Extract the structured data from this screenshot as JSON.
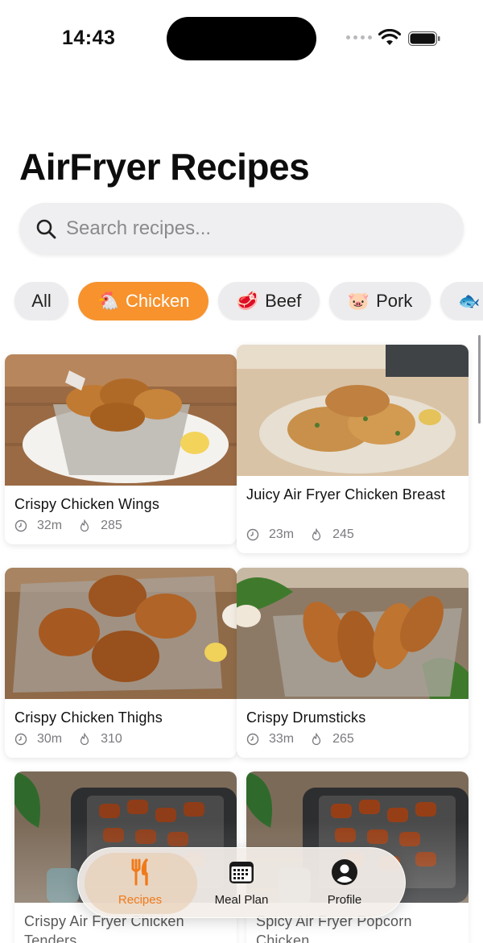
{
  "status_bar": {
    "time": "14:43"
  },
  "header": {
    "title": "AirFryer Recipes"
  },
  "search": {
    "placeholder": "Search recipes..."
  },
  "categories": [
    {
      "label": "All",
      "emoji": "",
      "active": false
    },
    {
      "label": "Chicken",
      "emoji": "🐔",
      "active": true
    },
    {
      "label": "Beef",
      "emoji": "🥩",
      "active": false
    },
    {
      "label": "Pork",
      "emoji": "🐷",
      "active": false
    },
    {
      "label": "",
      "emoji": "🐟",
      "active": false
    }
  ],
  "recipes": [
    {
      "title": "Crispy Chicken Wings",
      "time": "32m",
      "calories": "285"
    },
    {
      "title": "Juicy Air Fryer Chicken Breast",
      "time": "23m",
      "calories": "245"
    },
    {
      "title": "Crispy Chicken Thighs",
      "time": "30m",
      "calories": "310"
    },
    {
      "title": "Crispy Drumsticks",
      "time": "33m",
      "calories": "265"
    },
    {
      "title": "Crispy Air Fryer Chicken Tenders",
      "time": "",
      "calories": ""
    },
    {
      "title": "Spicy Air Fryer Popcorn Chicken",
      "time": "",
      "calories": ""
    }
  ],
  "tab_bar": {
    "tabs": [
      {
        "label": "Recipes",
        "icon": "fork-knife-icon",
        "active": true
      },
      {
        "label": "Meal Plan",
        "icon": "calendar-icon",
        "active": false
      },
      {
        "label": "Profile",
        "icon": "person-circle-icon",
        "active": false
      }
    ]
  },
  "colors": {
    "accent": "#f7922d",
    "chip_bg": "#ececee",
    "active_tab": "#f07a1a"
  }
}
